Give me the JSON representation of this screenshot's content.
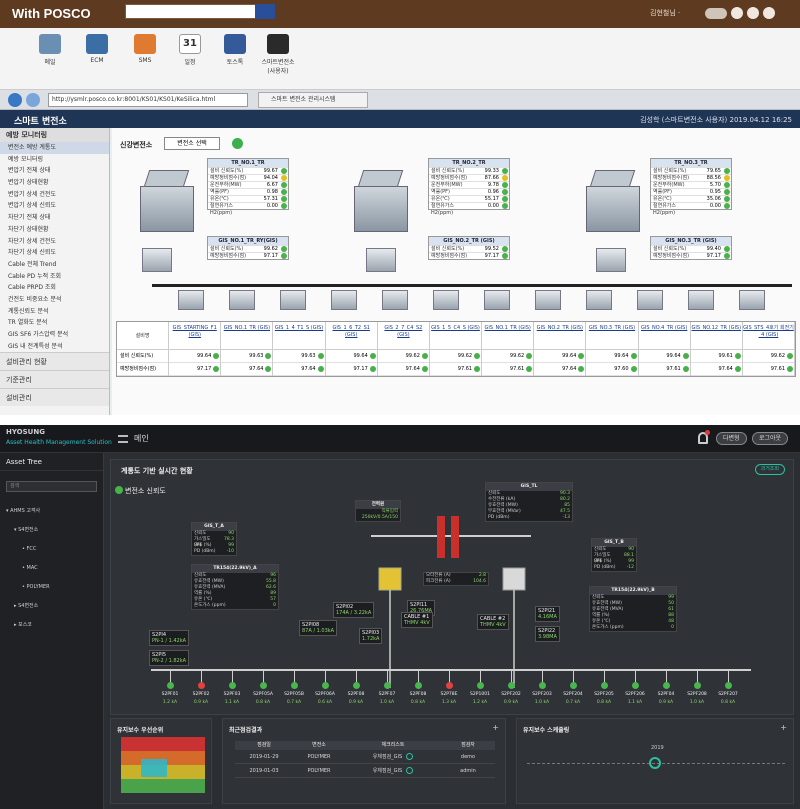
{
  "top": {
    "portal_logo": "With POSCO",
    "portal_user": "김현철님 ·",
    "apps": [
      {
        "label": "메일",
        "icon": "mail-icon",
        "color": "#6b8fb2"
      },
      {
        "label": "ECM",
        "icon": "ecm-icon",
        "color": "#3a6ea5"
      },
      {
        "label": "SMS",
        "icon": "sms-icon",
        "color": "#e07a30"
      },
      {
        "label": "일정",
        "icon": "calendar-icon",
        "color": "#f2f2f2"
      },
      {
        "label": "토스톡",
        "icon": "chat-icon",
        "color": "#345a9a"
      },
      {
        "label": "스마트변전소\n(사용자)",
        "icon": "camera-icon",
        "color": "#2a2a2a"
      }
    ],
    "address": "http://ysmlr.posco.co.kr:8001/KS01/KS01/KeSilica.html",
    "browser_tab": "스마트 변전소 관리시스템",
    "app_title": "스마트 변전소",
    "header_right": "김성학 (스마트변전소 사용자)   2019.04.12 16:25",
    "sidebar": {
      "heading": "예방 모니터링",
      "items": [
        "변전소 예방 계통도",
        "예방 모니터링",
        "변압기 전체 상태",
        "변압기 상태현황",
        "변압기 상세 건전도",
        "변압기 상세 신뢰도",
        "차단기 전체 상태",
        "차단기 상태현황",
        "차단기 상세 건전도",
        "차단기 상세 신뢰도",
        "Cable 전체 Trend",
        "Cable PD 누적 조회",
        "Cable PRPD 조회",
        "건전도 비중요소 분석",
        "계통신뢰도 분석",
        "TR 열화도 분석",
        "GIS SF6 가스압력 분석",
        "GIS 내 전계특성 분석"
      ],
      "sections": [
        "설비관리 현황",
        "기준관리",
        "설비관리"
      ]
    },
    "selector_label": "신강변전소",
    "selector_value": "변전소 선택",
    "panels": [
      {
        "title": "TR_NO.1_TR",
        "rows": [
          [
            "설비 신뢰도(%)",
            "99.67"
          ],
          [
            "예방정비점수(점)",
            "94.04"
          ],
          [
            "운전부하(MW)",
            "6.67"
          ],
          [
            "역률(PF)",
            "0.98"
          ],
          [
            "유온(℃)",
            "57.31"
          ],
          [
            "절연유가스 H2(ppm)",
            "0.00"
          ]
        ]
      },
      {
        "title": "TR_NO.2_TR",
        "rows": [
          [
            "설비 신뢰도(%)",
            "99.33"
          ],
          [
            "예방정비점수(점)",
            "87.66"
          ],
          [
            "운전부하(MW)",
            "9.78"
          ],
          [
            "역률(PF)",
            "0.96"
          ],
          [
            "유온(℃)",
            "55.17"
          ],
          [
            "절연유가스 H2(ppm)",
            "0.00"
          ]
        ]
      },
      {
        "title": "TR_NO.3_TR",
        "rows": [
          [
            "설비 신뢰도(%)",
            "79.65"
          ],
          [
            "예방정비점수(점)",
            "88.56"
          ],
          [
            "운전부하(MW)",
            "5.70"
          ],
          [
            "역률(PF)",
            "0.95"
          ],
          [
            "유온(℃)",
            "35.06"
          ],
          [
            "절연유가스 H2(ppm)",
            "0.00"
          ]
        ]
      },
      {
        "title": "GIS_NO.1_TR_RY(GIS)",
        "rows": [
          [
            "설비 신뢰도(%)",
            "99.62"
          ],
          [
            "예방정비점수(점)",
            "97.17"
          ]
        ]
      },
      {
        "title": "GIS_NO.2_TR (GIS)",
        "rows": [
          [
            "설비 신뢰도(%)",
            "99.52"
          ],
          [
            "예방정비점수(점)",
            "97.17"
          ]
        ]
      },
      {
        "title": "GIS_NO.3_TR (GIS)",
        "rows": [
          [
            "설비 신뢰도(%)",
            "99.40"
          ],
          [
            "예방정비점수(점)",
            "97.17"
          ]
        ]
      }
    ],
    "grid": {
      "row_labels": [
        "설비명",
        "설비 신뢰도(%)",
        "예방정비점수(점)"
      ],
      "columns": [
        {
          "name": "GIS_STARTING_F1 (GIS)",
          "rel": "99.64",
          "score": "97.17"
        },
        {
          "name": "GIS_NO.1_TR (GIS)",
          "rel": "99.63",
          "score": "97.64"
        },
        {
          "name": "GIS_1_4_T1_S (GIS)",
          "rel": "99.63",
          "score": "97.64"
        },
        {
          "name": "GIS_1_6_T2_S1 (GIS)",
          "rel": "99.64",
          "score": "97.17"
        },
        {
          "name": "GIS_2_7_C4_S2 (GIS)",
          "rel": "99.62",
          "score": "97.64"
        },
        {
          "name": "GIS_1_5_C4_S (GIS)",
          "rel": "99.62",
          "score": "97.61"
        },
        {
          "name": "GIS_NO.1_TR (GIS)",
          "rel": "99.62",
          "score": "97.61"
        },
        {
          "name": "GIS_NO.2_TR (GIS)",
          "rel": "99.64",
          "score": "97.64"
        },
        {
          "name": "GIS_NO.3_TR (GIS)",
          "rel": "99.64",
          "score": "97.60"
        },
        {
          "name": "GIS_NO.4_TR (GIS)",
          "rel": "99.64",
          "score": "97.61"
        },
        {
          "name": "GIS_NO.12_TR (GIS)",
          "rel": "99.61",
          "score": "97.64"
        },
        {
          "name": "GIS_STS_4호기 회전기_4 (GIS)",
          "rel": "99.62",
          "score": "97.61"
        }
      ]
    }
  },
  "bottom": {
    "logo": "HYOSUNG",
    "logo_sub": "Asset Health Management Solution",
    "home": "메인",
    "user_btn": "다변형",
    "logout_btn": "로그아웃",
    "asset_tree": "Asset Tree",
    "search_placeholder": "검색",
    "tree": [
      "▾ AHMS 고객사",
      "  ▾ S4변전소",
      "    • FCC",
      "    • MAC",
      "    • POLYMER",
      "  ▸ S4변전소",
      "  ▸ 포스코"
    ],
    "main_title": "계통도 기반 실시간 현황",
    "history_btn": "과거조회",
    "sub_title": "변전소 신뢰도",
    "top_panels": [
      {
        "title": "GIS_T_A",
        "rows": [
          "신뢰도",
          "가스밀도 (M)",
          "SF6 (%)",
          "PD (dBm)"
        ],
        "vals": [
          "90",
          "78.3",
          "99",
          "-10"
        ]
      },
      {
        "title": "GIS_T_B",
        "rows": [
          "신뢰도",
          "가스밀도 (M)",
          "SF6 (%)",
          "PD (dBm)"
        ],
        "vals": [
          "90",
          "88.1",
          "99",
          "-12"
        ]
      },
      {
        "title": "GIS_TL",
        "rows": [
          "신뢰도",
          "수전전류 (kA)",
          "유효전력 (MW)",
          "무효전력 (MVar)",
          "PD (dBm)"
        ],
        "vals": [
          "90.3",
          "80.2",
          "85",
          "47.5",
          "-13"
        ]
      },
      {
        "title": "TR154(22.9kV)_A",
        "rows": [
          "신뢰도",
          "유효전력 (MW)",
          "유효전력 (MVA)",
          "역률 (%)",
          "유온 (℃)",
          "온도가스 (ppm)"
        ],
        "vals": [
          "96",
          "55.8",
          "62.6",
          "89",
          "57",
          "0"
        ]
      },
      {
        "title": "TR154(22.9kV)_B",
        "rows": [
          "신뢰도",
          "유효전력 (MW)",
          "유효전력 (MVA)",
          "역률 (%)",
          "유온 (℃)",
          "온도가스 (ppm)"
        ],
        "vals": [
          "99",
          "50",
          "61",
          "88",
          "48",
          "0"
        ]
      }
    ],
    "center_panel": {
      "title": "전력원",
      "l1": "직류입력",
      "l2": "250kV/0.5A/150"
    },
    "center_rows": [
      "모터전류 (A)",
      "피크전류 (A)"
    ],
    "center_vals": [
      "2.8",
      "104.6"
    ],
    "labels": [
      {
        "t": "S2PI4",
        "v": "PN-1 / 1.42kA"
      },
      {
        "t": "S2PI5",
        "v": "PN-2 / 1.82kA"
      },
      {
        "t": "S2PI02",
        "v": "174A / 3.22kA"
      },
      {
        "t": "S2PI08",
        "v": "87A / 1.03kA"
      },
      {
        "t": "S2PI03",
        "v": "1.72kA"
      },
      {
        "t": "S2PI11",
        "v": "26.76MA"
      },
      {
        "t": "S2PI21",
        "v": "4.16MA"
      },
      {
        "t": "S2PI22",
        "v": "3.98MA"
      },
      {
        "t": "CABLE #1",
        "v": "THMV 4kV"
      },
      {
        "t": "CABLE #2",
        "v": "THMV 4kV"
      }
    ],
    "feeders": [
      "S2PF01",
      "S2PF02",
      "S2PF03",
      "S2PF05A",
      "S2PF05B",
      "S2PF06A",
      "S2PF08",
      "S2PF07",
      "S2PF08",
      "S2P78E",
      "S2P1001",
      "S2PF202",
      "S2PF203",
      "S2PF204",
      "S2PF205",
      "S2PF206",
      "S2PF04",
      "S2PF208",
      "S2PF207"
    ],
    "feeder_red": [
      1,
      9
    ],
    "feeder_vals": [
      "1.2 kA",
      "0.9 kA",
      "1.1 kA",
      "0.8 kA",
      "0.7 kA",
      "0.6 kA",
      "0.9 kA",
      "1.0 kA",
      "0.8 kA",
      "1.3 kA",
      "1.2 kA",
      "0.9 kA",
      "1.0 kA",
      "0.7 kA",
      "0.8 kA",
      "1.1 kA",
      "0.9 kA",
      "1.0 kA",
      "0.8 kA"
    ],
    "priority_title": "유지보수 우선순위",
    "recent_title": "최근점검결과",
    "recent_headers": [
      "점검일",
      "변전소",
      "체크리스트",
      "점검자"
    ],
    "recent_rows": [
      {
        "date": "2019-01-29",
        "site": "POLYMER",
        "check": "유체점검_GIS",
        "who": "demo"
      },
      {
        "date": "2019-01-03",
        "site": "POLYMER",
        "check": "유체점검_GIS",
        "who": "admin"
      }
    ],
    "schedule_title": "유지보수 스케줄링",
    "schedule_year": "2019",
    "colors": {
      "bg": "#2b2e33",
      "panel": "#1d1f22",
      "accent": "#2cc0a0",
      "ok": "#49b54d",
      "bad": "#e34040"
    }
  }
}
